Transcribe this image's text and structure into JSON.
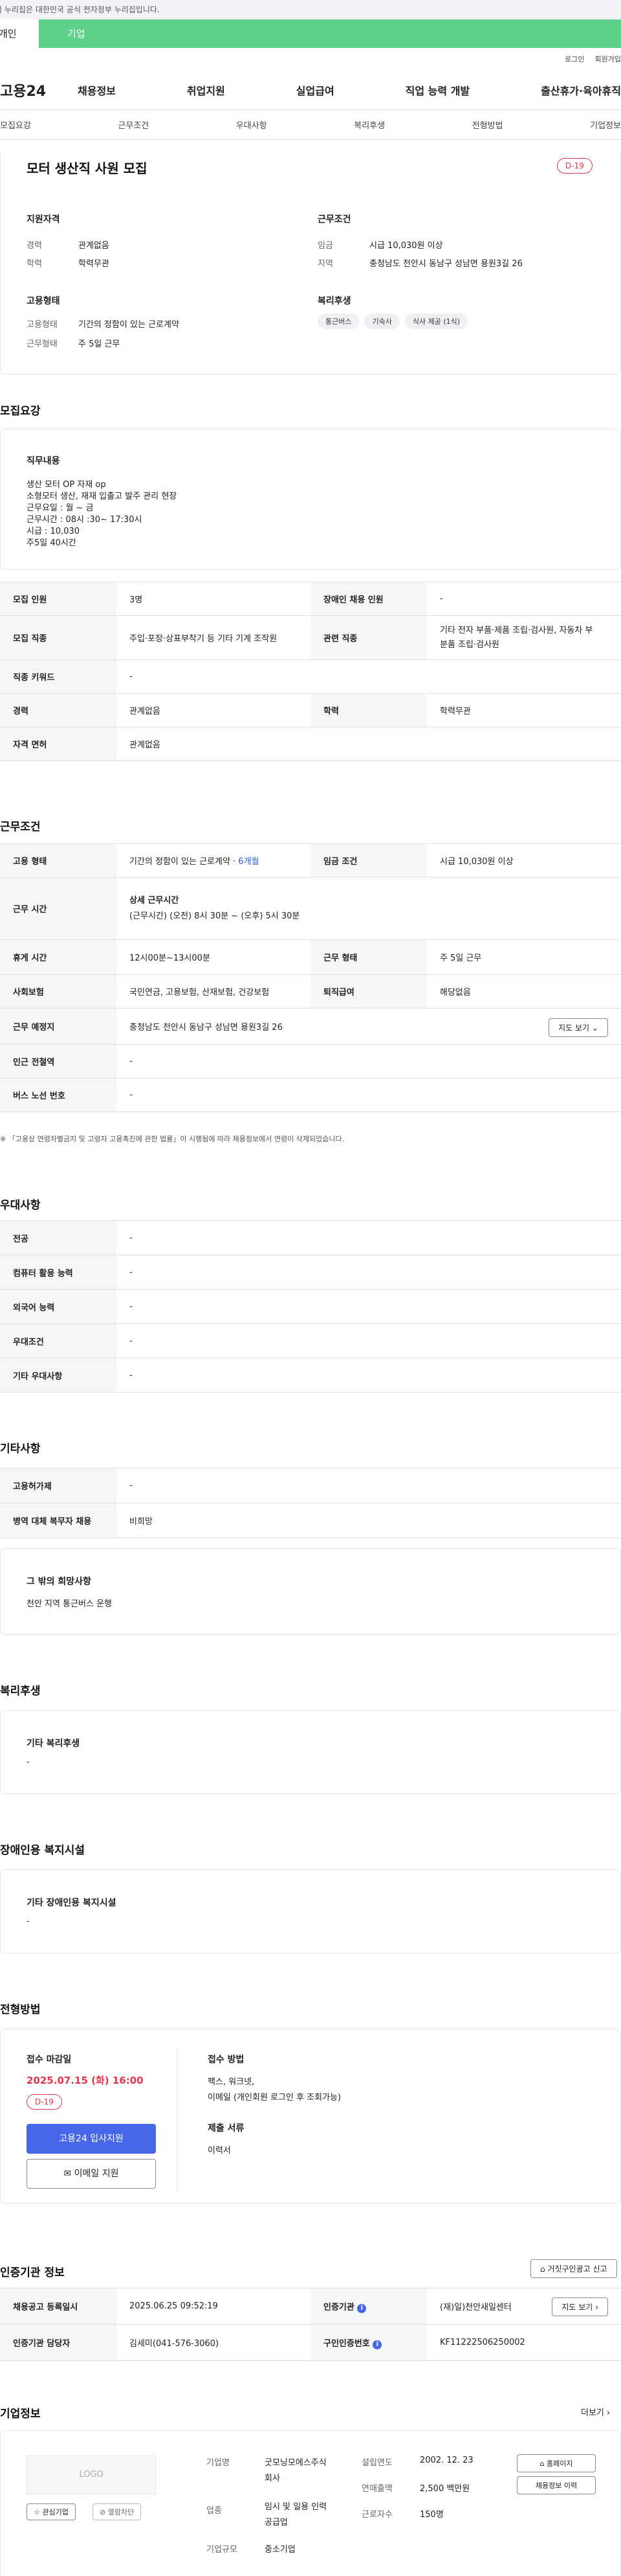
{
  "gov_banner": "이 누리집은 대한민국 공식 전자정부 누리집입니다.",
  "mode_tabs": {
    "personal": "개인",
    "company": "기업"
  },
  "utility": {
    "login": "로그인",
    "join": "회원가입"
  },
  "site": {
    "logo": "고용24"
  },
  "gnb": [
    "채용정보",
    "취업지원",
    "실업급여",
    "직업 능력 개발",
    "출산휴가·육아휴직"
  ],
  "anchor_tabs": [
    "모집요강",
    "근무조건",
    "우대사항",
    "복리후생",
    "전형방법",
    "기업정보"
  ],
  "job": {
    "title": "모터 생산직 사원 모집",
    "dday": "D-19",
    "qual_title": "지원자격",
    "qual": [
      {
        "label": "경력",
        "value": "관계없음"
      },
      {
        "label": "학력",
        "value": "학력무관"
      }
    ],
    "cond_title": "근무조건",
    "cond": [
      {
        "label": "임금",
        "value": "시급 10,030원 이상"
      },
      {
        "label": "지역",
        "value": "충청남도 천안시 동남구 성남면 용원3길 26"
      }
    ],
    "emp_title": "고용형태",
    "emp": [
      {
        "label": "고용형태",
        "value": "기간의 정함이 있는 근로계약"
      },
      {
        "label": "근무형태",
        "value": "주 5일 근무"
      }
    ],
    "welfare_title": "복리후생",
    "welfare_chips": [
      "통근버스",
      "기숙사",
      "식사 제공 (1식)"
    ]
  },
  "recruit": {
    "section_title": "모집요강",
    "duty_title": "직무내용",
    "duty_lines": [
      "생산 모터 OP 자재 op",
      "소형모터 생산, 재재 입출고 발주 관리 현장",
      "근무요일 : 월 ~ 금",
      "근무시간 : 08시 :30~ 17:30시",
      "시급 : 10,030",
      "주5일 40시간"
    ],
    "rows": [
      {
        "l1": "모집 인원",
        "v1": "3명",
        "l2": "장애인 채용 인원",
        "v2": "-"
      },
      {
        "l1": "모집 직종",
        "v1": "주입·포장·상표부착기 등 기타 기계 조작원",
        "l2": "관련 직종",
        "v2a": "기타 전자 부품·제품 조립·검사원, 자동차 부",
        "v2b": "분품 조립·검사원"
      },
      {
        "l1": "직종 키워드",
        "v1": "-"
      },
      {
        "l1": "경력",
        "v1": "관계없음",
        "l2": "학력",
        "v2": "학력무관"
      },
      {
        "l1": "자격 면허",
        "v1": "관계없음"
      }
    ]
  },
  "work": {
    "section_title": "근무조건",
    "emp_label": "고용 형태",
    "emp_value": "기간의 정함이 있는 근로계약 · ",
    "emp_period": "6개월",
    "wage_label": "임금 조건",
    "wage_value": "시급 10,030원 이상",
    "hours_label": "근무 시간",
    "hours_title": "상세 근무시간",
    "hours_value": "(근무시간) (오전) 8시 30분 ~ (오후) 5시 30분",
    "break_label": "휴게 시간",
    "break_value": "12시00분~13시00분",
    "type_label": "근무 형태",
    "type_value": "주 5일 근무",
    "ins_label": "사회보험",
    "ins_value": "국민연금, 고용보험, 산재보험, 건강보험",
    "sev_label": "퇴직급여",
    "sev_value": "해당없음",
    "place_label": "근무 예정지",
    "place_value": "충청남도 천안시 동남구 성남면 용원3길 26",
    "map_button": "지도 보기",
    "subway_label": "인근 전철역",
    "subway_value": "-",
    "bus_label": "버스 노선 번호",
    "bus_value": "-",
    "notice": "「고용상 연령차별금지 및 고령자 고용촉진에 관한 법률」이 시행됨에 따라 채용정보에서 연령이 삭제되었습니다."
  },
  "prefer": {
    "section_title": "우대사항",
    "rows": [
      {
        "label": "전공",
        "value": "-"
      },
      {
        "label": "컴퓨터 활용 능력",
        "value": "-"
      },
      {
        "label": "외국어 능력",
        "value": "-"
      },
      {
        "label": "우대조건",
        "value": "-"
      },
      {
        "label": "기타 우대사항",
        "value": "-"
      }
    ]
  },
  "etc": {
    "section_title": "기타사항",
    "rows": [
      {
        "label": "고용허가제",
        "value": "-"
      },
      {
        "label": "병역 대체 복무자 채용",
        "value": "비희망"
      }
    ],
    "other_title": "그 밖의 희망사항",
    "other_value": "천안 지역 통근버스 운행"
  },
  "benefit": {
    "section_title": "복리후생",
    "sub_title": "기타 복리후생",
    "value": "-"
  },
  "disabled": {
    "section_title": "장애인용 복지시설",
    "sub_title": "기타 장애인용 복지시설",
    "value": "-"
  },
  "process": {
    "section_title": "전형방법",
    "deadline_title": "접수 마감일",
    "deadline": "2025.07.15 (화) 16:00",
    "dday": "D-19",
    "apply_button": "고용24 입사지원",
    "email_button": "이메일 지원",
    "method_title": "접수 방법",
    "method_lines": [
      "팩스, 워크넷,",
      "이메일 (개인회원 로그인 후 조회가능)"
    ],
    "docs_title": "제출 서류",
    "docs_value": "이력서"
  },
  "agency": {
    "section_title": "인증기관 정보",
    "report_button": "거짓구인광고 신고",
    "reg_label": "채용공고 등록일시",
    "reg_value": "2025.06.25 09:52:19",
    "org_label": "인증기관",
    "org_value": "(재)일)천안새일센터",
    "manager_label": "인증기관 담당자",
    "manager_value": "김세미(041-576-3060)",
    "cert_label": "구인인증번호",
    "cert_value": "KF11222506250002",
    "map_button": "지도 보기"
  },
  "company": {
    "section_title": "기업정보",
    "more": "더보기",
    "logo_placeholder": "LOGO",
    "fav_button": "관심기업",
    "block_button": "열람차단",
    "name_label": "기업명",
    "name_lines": [
      "굿모닝모에스주식",
      "회사"
    ],
    "industry_label": "업종",
    "industry_lines": [
      "임시 및 일용 인력",
      "공급업"
    ],
    "size_label": "기업규모",
    "size_value": "중소기업",
    "founded_label": "설립연도",
    "founded_value": "2002. 12. 23",
    "sales_label": "연매출액",
    "sales_value": "2,500 백만원",
    "staff_label": "근로자수",
    "staff_value": "150명",
    "homepage_button": "홈페이지",
    "history_button": "채용정보 이력"
  }
}
